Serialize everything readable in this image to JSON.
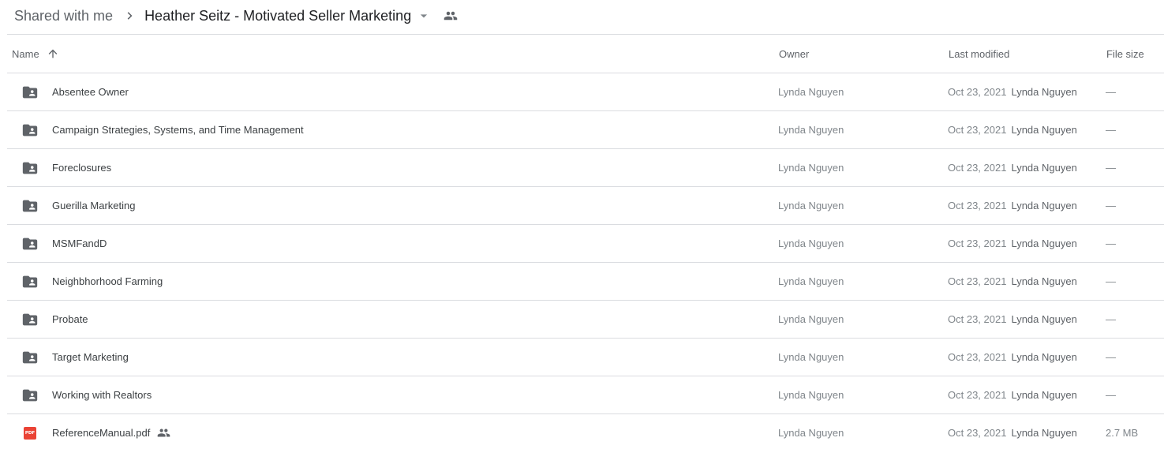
{
  "breadcrumb": {
    "root": "Shared with me",
    "current": "Heather Seitz - Motivated Seller Marketing"
  },
  "columns": {
    "name": "Name",
    "owner": "Owner",
    "last_modified": "Last modified",
    "file_size": "File size",
    "sort": "ascending"
  },
  "rows": [
    {
      "name": "Absentee Owner",
      "type": "shared-folder",
      "owner": "Lynda Nguyen",
      "modified_date": "Oct 23, 2021",
      "modified_by": "Lynda Nguyen",
      "size": "—"
    },
    {
      "name": "Campaign Strategies, Systems, and Time Management",
      "type": "shared-folder",
      "owner": "Lynda Nguyen",
      "modified_date": "Oct 23, 2021",
      "modified_by": "Lynda Nguyen",
      "size": "—"
    },
    {
      "name": "Foreclosures",
      "type": "shared-folder",
      "owner": "Lynda Nguyen",
      "modified_date": "Oct 23, 2021",
      "modified_by": "Lynda Nguyen",
      "size": "—"
    },
    {
      "name": "Guerilla Marketing",
      "type": "shared-folder",
      "owner": "Lynda Nguyen",
      "modified_date": "Oct 23, 2021",
      "modified_by": "Lynda Nguyen",
      "size": "—"
    },
    {
      "name": "MSMFandD",
      "type": "shared-folder",
      "owner": "Lynda Nguyen",
      "modified_date": "Oct 23, 2021",
      "modified_by": "Lynda Nguyen",
      "size": "—"
    },
    {
      "name": "Neighbhorhood Farming",
      "type": "shared-folder",
      "owner": "Lynda Nguyen",
      "modified_date": "Oct 23, 2021",
      "modified_by": "Lynda Nguyen",
      "size": "—"
    },
    {
      "name": "Probate",
      "type": "shared-folder",
      "owner": "Lynda Nguyen",
      "modified_date": "Oct 23, 2021",
      "modified_by": "Lynda Nguyen",
      "size": "—"
    },
    {
      "name": "Target Marketing",
      "type": "shared-folder",
      "owner": "Lynda Nguyen",
      "modified_date": "Oct 23, 2021",
      "modified_by": "Lynda Nguyen",
      "size": "—"
    },
    {
      "name": "Working with Realtors",
      "type": "shared-folder",
      "owner": "Lynda Nguyen",
      "modified_date": "Oct 23, 2021",
      "modified_by": "Lynda Nguyen",
      "size": "—"
    },
    {
      "name": "ReferenceManual.pdf",
      "type": "pdf",
      "icon_text": "PDF",
      "shared": true,
      "owner": "Lynda Nguyen",
      "modified_date": "Oct 23, 2021",
      "modified_by": "Lynda Nguyen",
      "size": "2.7 MB"
    }
  ],
  "colors": {
    "folder": "#5f6368",
    "pdf": "#ea4335",
    "divider": "#dadce0"
  }
}
